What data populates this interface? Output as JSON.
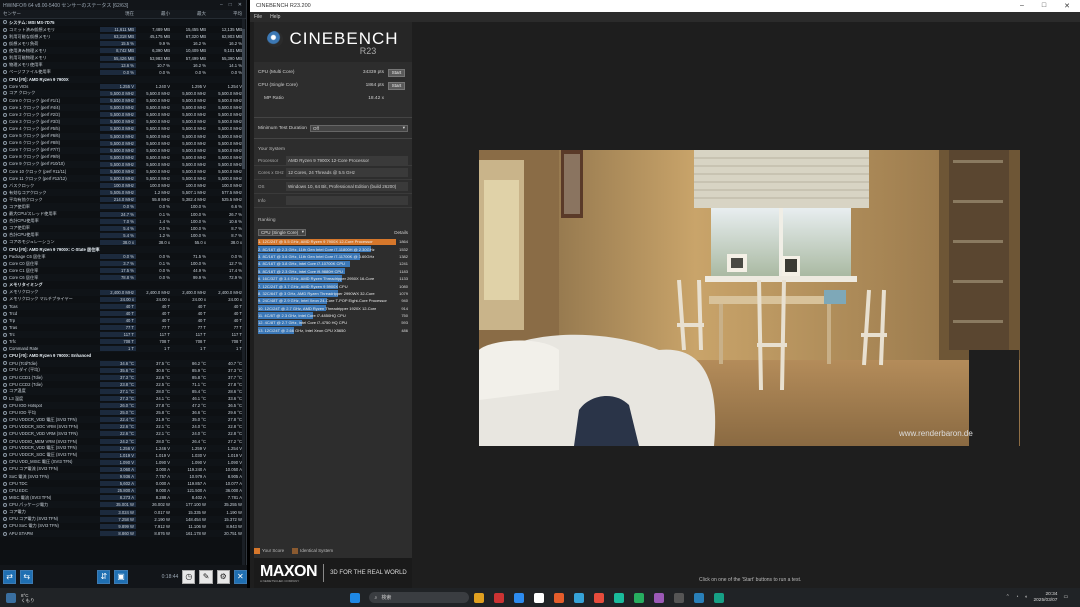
{
  "hwinfo": {
    "title": "HWiNFO® 64 v8.00-5400 センサーのステータス [62/63]",
    "headers": [
      "センサー",
      "現在",
      "最小",
      "最大",
      "平均"
    ],
    "rows": [
      {
        "g": 1,
        "n": "システム: MSI MS-7D75"
      },
      {
        "n": "コミット済み仮想メモリ",
        "v": [
          "11,611 MB",
          "7,489 MB",
          "15,455 MB",
          "12,135 MB"
        ]
      },
      {
        "n": "利用可能な仮想メモリ",
        "v": [
          "63,318 MB",
          "45,175 MB",
          "67,320 MB",
          "62,903 MB"
        ]
      },
      {
        "n": "仮想メモリ負荷",
        "v": [
          "15.5 %",
          "9.9 %",
          "16.2 %",
          "16.2 %"
        ]
      },
      {
        "n": "使用済み物理メモリ",
        "v": [
          "8,742 MB",
          "6,390 MB",
          "10,409 MB",
          "9,101 MB"
        ]
      },
      {
        "n": "利用可能物理メモリ",
        "v": [
          "55,426 MB",
          "53,983 MB",
          "57,499 MB",
          "55,390 MB"
        ]
      },
      {
        "n": "物理メモリ使用率",
        "v": [
          "13.6 %",
          "10.7 %",
          "16.2 %",
          "14.1 %"
        ]
      },
      {
        "n": "ページファイル使用率",
        "v": [
          "0.0 %",
          "0.0 %",
          "0.0 %",
          "0.0 %"
        ]
      },
      {
        "g": 1,
        "n": "CPU [#0]: AMD Ryzen 9 7900X"
      },
      {
        "n": "Core VIDs",
        "v": [
          "1.255 V",
          "1.240 V",
          "1.295 V",
          "1.254 V"
        ]
      },
      {
        "n": "コア クロック",
        "v": [
          "5,500.0 MHz",
          "5,500.0 MHz",
          "5,500.0 MHz",
          "5,500.0 MHz"
        ]
      },
      {
        "n": "Core 0 クロック (perf #1/1)",
        "v": [
          "5,500.0 MHz",
          "5,500.0 MHz",
          "5,500.0 MHz",
          "5,500.0 MHz"
        ]
      },
      {
        "n": "Core 1 クロック (perf #4/4)",
        "v": [
          "5,500.0 MHz",
          "5,500.0 MHz",
          "5,500.0 MHz",
          "5,500.0 MHz"
        ]
      },
      {
        "n": "Core 2 クロック (perf #2/2)",
        "v": [
          "5,500.0 MHz",
          "5,500.0 MHz",
          "5,500.0 MHz",
          "5,500.0 MHz"
        ]
      },
      {
        "n": "Core 3 クロック (perf #3/3)",
        "v": [
          "5,500.0 MHz",
          "5,500.0 MHz",
          "5,500.0 MHz",
          "5,500.0 MHz"
        ]
      },
      {
        "n": "Core 4 クロック (perf #5/5)",
        "v": [
          "5,500.0 MHz",
          "5,500.0 MHz",
          "5,500.0 MHz",
          "5,500.0 MHz"
        ]
      },
      {
        "n": "Core 5 クロック (perf #6/6)",
        "v": [
          "5,500.0 MHz",
          "5,500.0 MHz",
          "5,500.0 MHz",
          "5,500.0 MHz"
        ]
      },
      {
        "n": "Core 6 クロック (perf #8/8)",
        "v": [
          "5,500.0 MHz",
          "5,500.0 MHz",
          "5,500.0 MHz",
          "5,500.0 MHz"
        ]
      },
      {
        "n": "Core 7 クロック (perf #7/7)",
        "v": [
          "5,500.0 MHz",
          "5,500.0 MHz",
          "5,500.0 MHz",
          "5,500.0 MHz"
        ]
      },
      {
        "n": "Core 8 クロック (perf #9/9)",
        "v": [
          "5,500.0 MHz",
          "5,500.0 MHz",
          "5,500.0 MHz",
          "5,500.0 MHz"
        ]
      },
      {
        "n": "Core 9 クロック (perf #10/10)",
        "v": [
          "5,500.0 MHz",
          "5,500.0 MHz",
          "5,500.0 MHz",
          "5,500.0 MHz"
        ]
      },
      {
        "n": "Core 10 クロック (perf #11/11)",
        "v": [
          "5,500.0 MHz",
          "5,500.0 MHz",
          "5,500.0 MHz",
          "5,500.0 MHz"
        ]
      },
      {
        "n": "Core 11 クロック (perf #12/12)",
        "v": [
          "5,500.0 MHz",
          "5,500.0 MHz",
          "5,500.0 MHz",
          "5,500.0 MHz"
        ]
      },
      {
        "n": "バスクロック",
        "v": [
          "100.0 MHz",
          "100.0 MHz",
          "100.0 MHz",
          "100.0 MHz"
        ]
      },
      {
        "n": "有効なコアクロック",
        "v": [
          "5,505.0 MHz",
          "1.2 MHz",
          "5,507.1 MHz",
          "577.5 MHz"
        ]
      },
      {
        "n": "平均有効クロック",
        "v": [
          "214.0 MHz",
          "55.8 MHz",
          "5,382.4 MHz",
          "525.5 MHz"
        ]
      },
      {
        "n": "コア使用率",
        "v": [
          "0.0 %",
          "0.0 %",
          "100.0 %",
          "6.6 %"
        ]
      },
      {
        "n": "最大CPU/スレッド使用率",
        "v": [
          "24.7 %",
          "0.1 %",
          "100.0 %",
          "26.7 %"
        ]
      },
      {
        "n": "合計CPU使用率",
        "v": [
          "7.0 %",
          "1.4 %",
          "100.0 %",
          "10.6 %"
        ]
      },
      {
        "n": "コア使用率",
        "v": [
          "5.4 %",
          "0.0 %",
          "100.0 %",
          "8.7 %"
        ]
      },
      {
        "n": "合計CPU使用率",
        "v": [
          "5.4 %",
          "1.2 %",
          "100.0 %",
          "8.7 %"
        ]
      },
      {
        "n": "コアのモジュレーション",
        "v": [
          "38.0 x",
          "38.0 x",
          "55.0 x",
          "38.0 x"
        ]
      },
      {
        "g": 1,
        "n": "CPU [#0]: AMD Ryzen 9 7900X: C-State 居住率"
      },
      {
        "n": "Package C6 居住率",
        "v": [
          "0.0 %",
          "0.0 %",
          "71.5 %",
          "0.0 %"
        ]
      },
      {
        "n": "Core C0 居住率",
        "v": [
          "3.7 %",
          "0.1 %",
          "100.0 %",
          "12.7 %"
        ]
      },
      {
        "n": "Core C1 居住率",
        "v": [
          "17.5 %",
          "0.0 %",
          "44.9 %",
          "17.4 %"
        ]
      },
      {
        "n": "Core C6 居住率",
        "v": [
          "78.8 %",
          "0.0 %",
          "99.9 %",
          "72.9 %"
        ]
      },
      {
        "g": 1,
        "n": "メモリタイミング"
      },
      {
        "n": "メモリクロック",
        "v": [
          "2,400.0 MHz",
          "2,400.0 MHz",
          "2,400.0 MHz",
          "2,400.0 MHz"
        ]
      },
      {
        "n": "メモリクロック マルチプライヤー",
        "v": [
          "24.00 x",
          "24.00 x",
          "24.00 x",
          "24.00 x"
        ]
      },
      {
        "n": "Tcas",
        "v": [
          "40 T",
          "40 T",
          "40 T",
          "40 T"
        ]
      },
      {
        "n": "Trcd",
        "v": [
          "40 T",
          "40 T",
          "40 T",
          "40 T"
        ]
      },
      {
        "n": "Trp",
        "v": [
          "40 T",
          "40 T",
          "40 T",
          "40 T"
        ]
      },
      {
        "n": "Tras",
        "v": [
          "77 T",
          "77 T",
          "77 T",
          "77 T"
        ]
      },
      {
        "n": "Trc",
        "v": [
          "117 T",
          "117 T",
          "117 T",
          "117 T"
        ]
      },
      {
        "n": "Trfc",
        "v": [
          "708 T",
          "708 T",
          "708 T",
          "708 T"
        ]
      },
      {
        "n": "Command Rate",
        "v": [
          "1 T",
          "1 T",
          "1 T",
          "1 T"
        ]
      },
      {
        "g": 1,
        "n": "CPU [#0]: AMD Ryzen 9 7900X: Enhanced"
      },
      {
        "n": "CPU (Tctl/Tdie)",
        "v": [
          "34.6 °C",
          "37.5 °C",
          "86.2 °C",
          "40.7 °C"
        ]
      },
      {
        "n": "CPU ダイ (平均)",
        "v": [
          "35.6 °C",
          "30.6 °C",
          "85.9 °C",
          "37.3 °C"
        ]
      },
      {
        "n": "CPU CCD1 (Tdie)",
        "v": [
          "37.3 °C",
          "22.6 °C",
          "85.8 °C",
          "37.7 °C"
        ]
      },
      {
        "n": "CPU CCD2 (Tdie)",
        "v": [
          "23.8 °C",
          "22.5 °C",
          "71.1 °C",
          "27.8 °C"
        ]
      },
      {
        "n": "コア温度",
        "v": [
          "27.1 °C",
          "28.0 °C",
          "85.4 °C",
          "28.6 °C"
        ]
      },
      {
        "n": "L3 温度",
        "v": [
          "27.3 °C",
          "24.1 °C",
          "46.1 °C",
          "33.6 °C"
        ]
      },
      {
        "n": "CPU IOD Hotspot",
        "v": [
          "26.0 °C",
          "27.8 °C",
          "47.2 °C",
          "36.5 °C"
        ]
      },
      {
        "n": "CPU IOD 平均",
        "v": [
          "25.0 °C",
          "25.8 °C",
          "36.6 °C",
          "29.6 °C"
        ]
      },
      {
        "n": "CPU VDDCR_VDD 電圧 (SVI3 TFN)",
        "v": [
          "22.4 °C",
          "21.9 °C",
          "35.0 °C",
          "27.8 °C"
        ]
      },
      {
        "n": "CPU VDDCR_SOC VRM (SVI3 TFN)",
        "v": [
          "22.6 °C",
          "22.1 °C",
          "24.0 °C",
          "22.8 °C"
        ]
      },
      {
        "n": "CPU VDDCR_VDD VRM (SVI3 TFN)",
        "v": [
          "22.6 °C",
          "22.1 °C",
          "24.0 °C",
          "22.8 °C"
        ]
      },
      {
        "n": "CPU VDDIO_MEM VRM (SVI3 TFN)",
        "v": [
          "24.2 °C",
          "28.0 °C",
          "26.4 °C",
          "27.2 °C"
        ]
      },
      {
        "n": "CPU VDDCR_VDD 電圧 (SVI3 TFN)",
        "v": [
          "1.256 V",
          "1.246 V",
          "1.259 V",
          "1.254 V"
        ]
      },
      {
        "n": "CPU VDDCR_SOC 電圧 (SVI3 TFN)",
        "v": [
          "1.019 V",
          "1.019 V",
          "1.030 V",
          "1.019 V"
        ]
      },
      {
        "n": "CPU VDD_MISC 電圧 (SVI3 TFN)",
        "v": [
          "1.090 V",
          "1.090 V",
          "1.090 V",
          "1.090 V"
        ]
      },
      {
        "n": "CPU コア電流 (SVI3 TFN)",
        "v": [
          "3.060 A",
          "3.000 A",
          "119.240 A",
          "10.050 A"
        ]
      },
      {
        "n": "SoC 電流 (SVI3 TFN)",
        "v": [
          "9.936 A",
          "7.757 A",
          "10.979 A",
          "8.905 A"
        ]
      },
      {
        "n": "CPU TDC",
        "v": [
          "5,602 A",
          "0.000 A",
          "119.857 A",
          "10.077 A"
        ]
      },
      {
        "n": "CPU EDC",
        "v": [
          "25.800 A",
          "9.000 A",
          "121.500 A",
          "36.000 A"
        ]
      },
      {
        "n": "MISC 電流 (SVI3 TFN)",
        "v": [
          "8.273 A",
          "8.288 A",
          "8.402 A",
          "7.781 A"
        ]
      },
      {
        "n": "CPU パッケージ電力",
        "v": [
          "35.001 W",
          "26.002 W",
          "177.100 W",
          "35.255 W"
        ]
      },
      {
        "n": "コア電力",
        "v": [
          "3.024 W",
          "0.017 W",
          "15.335 W",
          "1.190 W"
        ]
      },
      {
        "n": "CPU コア電力 (SVI3 TFN)",
        "v": [
          "7.258 W",
          "2.190 W",
          "148.454 W",
          "15.372 W"
        ]
      },
      {
        "n": "CPU SoC 電力 (SVI3 TFN)",
        "v": [
          "9.899 W",
          "7.912 W",
          "11.106 W",
          "8.943 W"
        ]
      },
      {
        "n": "APU STAPM",
        "v": [
          "8.860 W",
          "8.876 W",
          "161.178 W",
          "20.751 W"
        ]
      }
    ],
    "foot_time": "0:18:44"
  },
  "cinebench": {
    "title": "CINEBENCH R23.200",
    "menu": [
      "File",
      "Help"
    ],
    "logo_text": "CINEBENCH",
    "logo_sub": "R23",
    "multi_label": "CPU (Multi Core)",
    "multi_value": "34339 pts",
    "start": "Start",
    "single_label": "CPU (Single Core)",
    "single_value": "1864 pts",
    "mp_label": "MP Ratio",
    "mp_value": "18.42 x",
    "min_label": "Minimum Test Duration",
    "min_value": "Off",
    "your_system": "Your System",
    "sys": [
      {
        "k": "Processor",
        "v": "AMD Ryzen 9 7900X 12-Core Processor"
      },
      {
        "k": "Cores x GHz",
        "v": "12 Cores, 24 Threads @ 5.5 GHz"
      },
      {
        "k": "OS",
        "v": "Windows 10, 64 Bit, Professional Edition (build 26200)"
      },
      {
        "k": "Info",
        "v": ""
      }
    ],
    "ranking": "Ranking",
    "rank_sel": "CPU (Single Core)",
    "details": "Details",
    "ranks": [
      {
        "t": "1. 12C/24T @ 5.5 GHz, AMD Ryzen 9 7900X 12-Core Processor",
        "s": "1864",
        "w": 1.0,
        "mine": true
      },
      {
        "t": "2. 8C/16T @ 2.3 GHz, 11th Gen Intel Core i7-11800H @ 2.30GHz",
        "s": "1532",
        "w": 0.82
      },
      {
        "t": "3. 8C/16T @ 3.6 GHz, 11th Gen Intel Core i7-11700K @ 3.60GHz",
        "s": "1382",
        "w": 0.74
      },
      {
        "t": "4. 8C/16T @ 3.8 GHz, Intel Core i7-10700K CPU",
        "s": "1241",
        "w": 0.67
      },
      {
        "t": "5. 8C/16T @ 2.3 GHz, Intel Core i9-9880H CPU",
        "s": "1183",
        "w": 0.63
      },
      {
        "t": "6. 16C/32T @ 3.4 GHz, AMD Ryzen Threadripper 2950X 16-Core",
        "s": "1133",
        "w": 0.61
      },
      {
        "t": "7. 12C/24T @ 3.7 GHz, AMD Ryzen 9 5900X CPU",
        "s": "1080",
        "w": 0.58
      },
      {
        "t": "8. 32C/64T @ 3 GHz, AMD Ryzen Threadripper 2990WX 32-Core",
        "s": "1079",
        "w": 0.58
      },
      {
        "t": "9. 24C/48T @ 2.9 GHz, Intel Xeon 24-Core T-POP Eight-Core Processor",
        "s": "940",
        "w": 0.5
      },
      {
        "t": "10. 12C/24T @ 2.7 GHz, AMD Ryzen Threadripper 1920X 12-Core",
        "s": "914",
        "w": 0.49
      },
      {
        "t": "11. 4C/8T @ 2.3 GHz, Intel Core i7-4850HQ CPU",
        "s": "750",
        "w": 0.4
      },
      {
        "t": "12. 4C/8T @ 2.7 GHz, Intel Core i7-4750 HQ CPU",
        "s": "593",
        "w": 0.32
      },
      {
        "t": "13. 12C/24T @ 2.66 GHz, Intel Xeon CPU X5650",
        "s": "486",
        "w": 0.26
      }
    ],
    "legend_yours": "Your Score",
    "legend_identical": "Identical System",
    "maxon": "MAXON",
    "maxon_sub": "A NEMETSCHEK COMPANY",
    "tagline": "3D FOR THE REAL WORLD",
    "watermark": "www.renderbaron.de",
    "hint": "Click on one of the 'Start' buttons to run a test."
  },
  "taskbar": {
    "search": "検索",
    "clock_time": "20:34",
    "clock_date": "2025/03/07",
    "weather": "8°C",
    "weather2": "くもり"
  },
  "colors": {
    "accent": "#3b78b8",
    "mine": "#d6772b"
  }
}
